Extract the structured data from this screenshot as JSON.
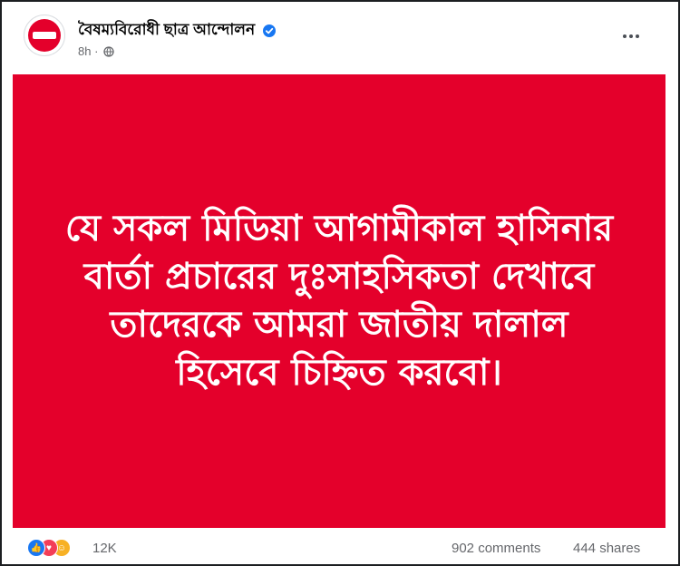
{
  "post": {
    "page_name": "বৈষম্যবিরোধী ছাত্র আন্দোলন",
    "time": "8h",
    "dot": "·",
    "verified_icon": "verified-badge-icon",
    "privacy_icon": "globe-icon",
    "image_text_lines": [
      "যে সকল মিডিয়া আগামীকাল হাসিনার",
      "বার্তা প্রচারের দুঃসাহসিকতা দেখাবে",
      "তাদেরকে আমরা জাতীয় দালাল",
      "হিসেবে চিহ্নিত করবো।"
    ],
    "image_background": "#e4002b"
  },
  "footer": {
    "reaction_icons": [
      "like-icon",
      "love-icon",
      "care-icon"
    ],
    "reaction_count": "12K",
    "comments": "902 comments",
    "shares": "444 shares"
  }
}
